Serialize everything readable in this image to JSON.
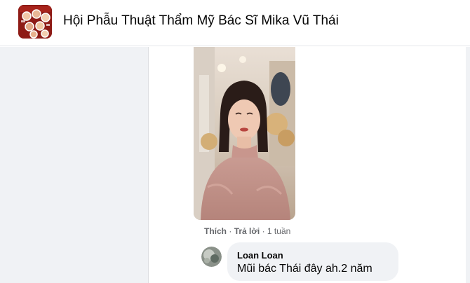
{
  "header": {
    "group_name": "Hội Phẫu Thuật Thẩm Mỹ Bác Sĩ Mika Vũ Thái",
    "avatar_icon": "group-collage-avatar-icon",
    "avatar_color": "#8e1b16"
  },
  "post": {
    "photo_icon": "portrait-photo"
  },
  "comment_actions": {
    "like_label": "Thích",
    "separator": "·",
    "reply_label": "Trả lời",
    "time": "1 tuần"
  },
  "reply": {
    "author": "Loan Loan",
    "text": "Mũi bác Thái đây ah.2 năm",
    "bubble_color": "#f0f2f5"
  },
  "colors": {
    "panel_bg": "#f0f2f5",
    "secondary_text": "#65676b",
    "primary_text": "#050505"
  }
}
